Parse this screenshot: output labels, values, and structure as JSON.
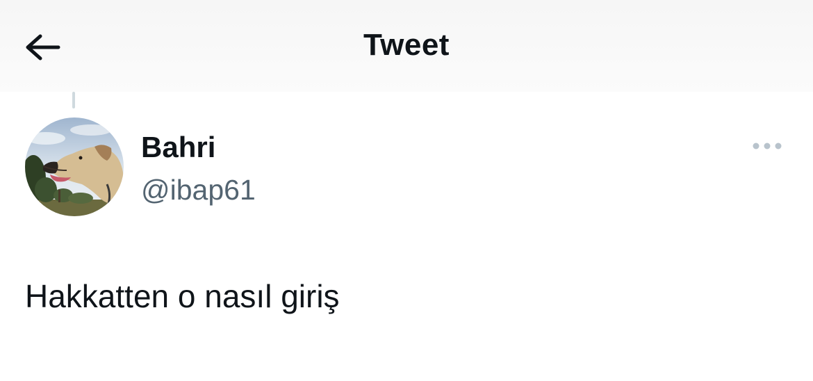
{
  "header": {
    "title": "Tweet",
    "back_icon": "arrow-left-icon"
  },
  "tweet": {
    "author": {
      "display_name": "Bahri",
      "handle": "@ibap61",
      "avatar_icon": "dog-avatar"
    },
    "more_icon": "ellipsis-icon",
    "text": "Hakkatten o nasıl giriş"
  },
  "colors": {
    "primary_text": "#0f1419",
    "secondary_text": "#536471",
    "thread_line": "#cfd9de",
    "more_dots": "#b8c3cc"
  }
}
